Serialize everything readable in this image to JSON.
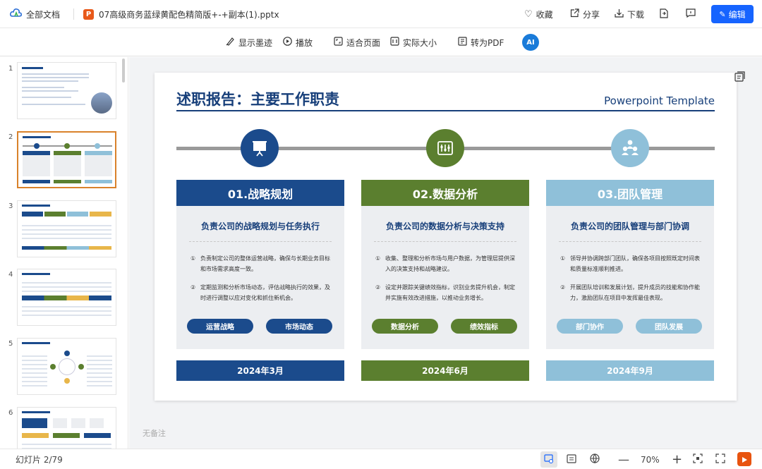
{
  "topbar": {
    "home_label": "全部文档",
    "file_name": "07高级商务蓝绿黄配色精简版+-+副本(1).pptx",
    "favorite_label": "收藏",
    "share_label": "分享",
    "download_label": "下载",
    "edit_label": "编辑"
  },
  "toolbar": {
    "ink_label": "显示墨迹",
    "play_label": "播放",
    "fit_label": "适合页面",
    "actual_label": "实际大小",
    "pdf_label": "转为PDF",
    "ai_label": "AI"
  },
  "sidebar": {
    "slides": [
      {
        "num": "1"
      },
      {
        "num": "2"
      },
      {
        "num": "3"
      },
      {
        "num": "4"
      },
      {
        "num": "5"
      },
      {
        "num": "6"
      }
    ]
  },
  "slide": {
    "title": "述职报告：主要工作职责",
    "subtitle": "Powerpoint Template",
    "columns": [
      {
        "color": "#1b4b8c",
        "heading": "01.战略规划",
        "sub": "负责公司的战略规划与任务执行",
        "item1": "负责制定公司的整体运营战略，确保与长期业务目标和市场需求高度一致。",
        "item2": "定期监测和分析市场动态，评估战略执行的效果，及时进行调整以应对变化和抓住新机会。",
        "tag1": "运营战略",
        "tag2": "市场动态",
        "date": "2024年3月"
      },
      {
        "color": "#5b7f2f",
        "heading": "02.数据分析",
        "sub": "负责公司的数据分析与决策支持",
        "item1": "收集、整理和分析市场与用户数据，为管理层提供深入的决策支持和战略建议。",
        "item2": "设定并跟踪关键绩效指标，识别业务提升机会，制定并实施有效改进措施，以推动业务增长。",
        "tag1": "数据分析",
        "tag2": "绩效指标",
        "date": "2024年6月"
      },
      {
        "color": "#8fc0d9",
        "heading": "03.团队管理",
        "sub": "负责公司的团队管理与部门协调",
        "item1": "领导并协调跨部门团队，确保各项目按照既定时间表和质量标准顺利推进。",
        "item2": "开展团队培训和发展计划，提升成员的技能和协作能力，激励团队在项目中发挥最佳表现。",
        "tag1": "部门协作",
        "tag2": "团队发展",
        "date": "2024年9月"
      }
    ],
    "num1": "①",
    "num2": "②"
  },
  "notes_placeholder": "无备注",
  "status": {
    "page_indicator": "幻灯片 2/79",
    "zoom": "70%"
  }
}
